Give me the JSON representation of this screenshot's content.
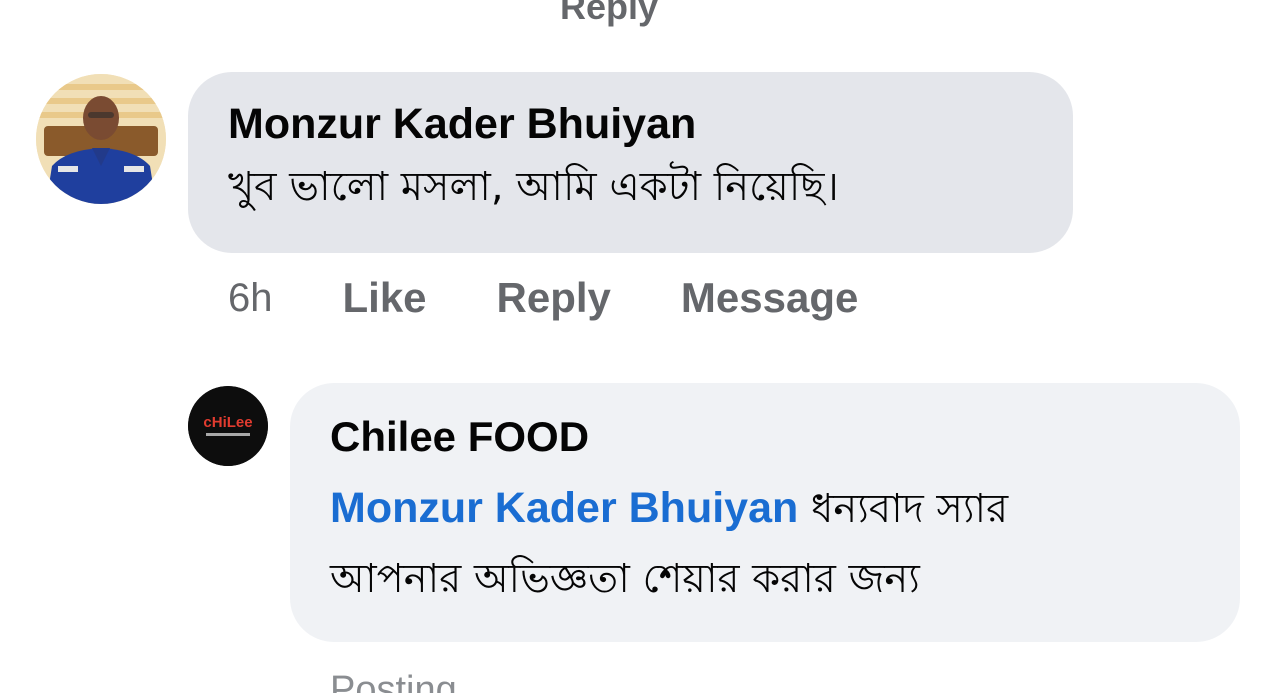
{
  "top_cut_text": "Reply",
  "comment": {
    "author": "Monzur Kader Bhuiyan",
    "text": "খুব ভালো মসলা, আমি একটা নিয়েছি।",
    "time": "6h",
    "like_label": "Like",
    "reply_label": "Reply",
    "message_label": "Message"
  },
  "reply": {
    "author": "Chilee FOOD",
    "avatar_logo_text": "cHiLee",
    "mention": "Monzur Kader Bhuiyan",
    "text_line1": "ধন্যবাদ স্যার",
    "text_line2": "আপনার অভিজ্ঞতা শেয়ার করার জন্য"
  },
  "status": "Posting",
  "colors": {
    "bubble_main": "#e4e6eb",
    "bubble_reply": "#f0f2f5",
    "mention_blue": "#1a6dd2",
    "secondary_text": "#65676b",
    "uniform_blue": "#1f3f9e"
  }
}
